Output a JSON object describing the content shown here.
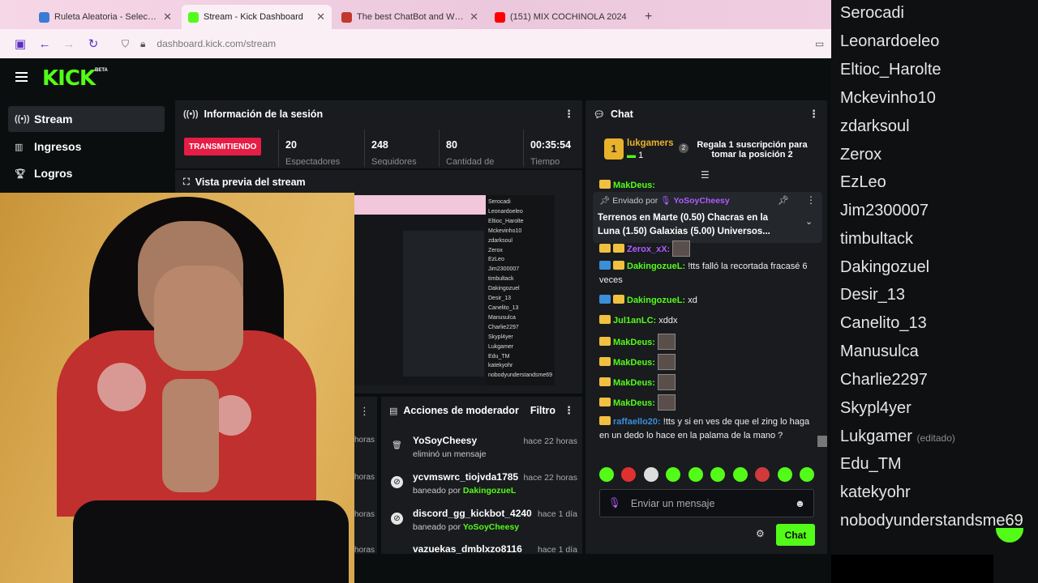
{
  "browser": {
    "tabs": [
      {
        "label": "Ruleta Aleatoria - Selector Persona",
        "fav": "#3a7bd5"
      },
      {
        "label": "Stream - Kick Dashboard",
        "fav": "#53fc18"
      },
      {
        "label": "The best ChatBot and Widgets",
        "fav": "#c0392b"
      },
      {
        "label": "(151) MIX COCHINOLA 2024",
        "fav": "#ff0000"
      }
    ],
    "url_host": "dashboard.kick.com",
    "url_path": "/stream"
  },
  "kick": {
    "logo": "KICK",
    "beta": "BETA"
  },
  "sidebar": {
    "items": [
      {
        "label": "Stream",
        "icon": "broadcast-icon"
      },
      {
        "label": "Ingresos",
        "icon": "chart-icon"
      },
      {
        "label": "Logros",
        "icon": "trophy-icon"
      }
    ]
  },
  "session": {
    "title": "Información de la sesión",
    "live": "TRANSMITIENDO",
    "stats": [
      {
        "value": "20",
        "label": "Espectadores"
      },
      {
        "value": "248",
        "label": "Seguidores"
      },
      {
        "value": "80",
        "label": "Cantidad de"
      },
      {
        "value": "00:35:54",
        "label": "Tiempo"
      }
    ]
  },
  "preview": {
    "title": "Vista previa del stream",
    "names": [
      "Serocadi",
      "Leonardoeleo",
      "Eltioc_Harolte",
      "Mckevinho10",
      "zdarksoul",
      "Zerox",
      "EzLeo",
      "Jim2300007",
      "timbultack",
      "Dakingozuel",
      "Desir_13",
      "Canelito_13",
      "Manusulca",
      "Charlie2297",
      "Skypl4yer",
      "Lukgamer",
      "Edu_TM",
      "katekyohr",
      "nobodyunderstandsme69"
    ]
  },
  "mod_actions": {
    "title": "Acciones de moderador",
    "filter": "Filtro",
    "rows": [
      {
        "user": "YoSoyCheesy",
        "time": "hace 22 horas",
        "desc": "eliminó un mensaje",
        "by": ""
      },
      {
        "user": "ycvmswrc_tiojvda1785",
        "time": "hace 22 horas",
        "desc": "baneado por ",
        "by": "DakingozueL"
      },
      {
        "user": "discord_gg_kickbot_4240",
        "time": "hace 1 día",
        "desc": "baneado por ",
        "by": "YoSoyCheesy"
      },
      {
        "user": "vazuekas_dmblxzo8116",
        "time": "hace 1 día",
        "desc": "",
        "by": ""
      }
    ],
    "side_times": [
      "horas",
      "horas",
      "horas",
      "horas"
    ]
  },
  "chat": {
    "title": "Chat",
    "top_user": "lukgamers",
    "top_count": "1",
    "rank": "1",
    "gift_rank": "2",
    "gift_text": "Regala 1 suscripción para tomar la posición 2",
    "pinned_by_label": "Enviado por",
    "pinned_by": "YoSoyCheesy",
    "pinned_text": "Terrenos en Marte (0.50) Chacras en la Luna (1.50) Galaxias (5.00) Universos...",
    "peek_user": "MakDeus:",
    "messages": [
      {
        "user": "Zerox_xX:",
        "color": "#b05cff",
        "text": ""
      },
      {
        "user": "DakingozueL:",
        "color": "#53fc18",
        "text": "!tts falló la recortada fracasé 6 veces"
      },
      {
        "user": "DakingozueL:",
        "color": "#53fc18",
        "text": "xd"
      },
      {
        "user": "Jul1anLC:",
        "color": "#53fc18",
        "text": "xddx"
      },
      {
        "user": "MakDeus:",
        "color": "#53fc18",
        "text": ""
      },
      {
        "user": "MakDeus:",
        "color": "#53fc18",
        "text": ""
      },
      {
        "user": "MakDeus:",
        "color": "#53fc18",
        "text": ""
      },
      {
        "user": "MakDeus:",
        "color": "#53fc18",
        "text": ""
      },
      {
        "user": "raffaello20:",
        "color": "#3a8fd8",
        "text": "!tts y si en ves de que el zing lo haga en un dedo lo hace en la palama de la mano ?"
      }
    ],
    "input_placeholder": "Enviar un mensaje",
    "send": "Chat"
  },
  "overlay_list": {
    "names": [
      "Serocadi",
      "Leonardoeleo",
      "Eltioc_Harolte",
      "Mckevinho10",
      "zdarksoul",
      "Zerox",
      "EzLeo",
      "Jim2300007",
      "timbultack",
      "Dakingozuel",
      "Desir_13",
      "Canelito_13",
      "Manusulca",
      "Charlie2297",
      "Skypl4yer",
      "Lukgamer",
      "Edu_TM",
      "katekyohr",
      "nobodyunderstandsme69"
    ],
    "edited": "(editado)"
  }
}
